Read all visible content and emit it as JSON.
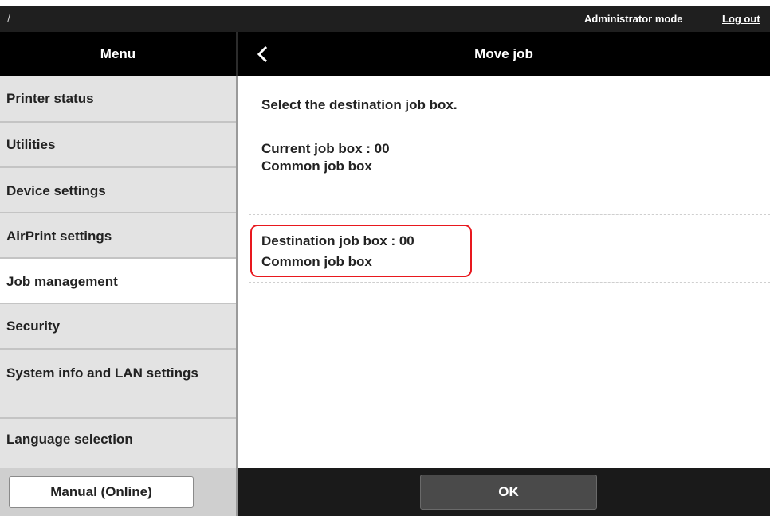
{
  "topbar": {
    "path": "/",
    "mode_label": "Administrator mode",
    "logout_label": "Log out"
  },
  "header": {
    "menu_title": "Menu",
    "back_icon": "chevron-left-icon",
    "page_title": "Move job"
  },
  "sidebar": {
    "items": [
      {
        "label": "Printer status",
        "active": false
      },
      {
        "label": "Utilities",
        "active": false
      },
      {
        "label": "Device settings",
        "active": false
      },
      {
        "label": "AirPrint settings",
        "active": false
      },
      {
        "label": "Job management",
        "active": true
      },
      {
        "label": "Security",
        "active": false
      },
      {
        "label": "System info and LAN settings",
        "active": false
      },
      {
        "label": "Language selection",
        "active": false
      }
    ]
  },
  "main": {
    "instruction": "Select the destination job box.",
    "current_box": {
      "line1": "Current job box : 00",
      "line2": "Common job box"
    },
    "destination_box": {
      "line1": "Destination job box : 00",
      "line2": "Common job box"
    }
  },
  "footer": {
    "manual_label": "Manual (Online)",
    "ok_label": "OK"
  },
  "colors": {
    "header_bg": "#000000",
    "sidebar_bg": "#e3e3e3",
    "active_item_bg": "#ffffff",
    "highlight_border": "#e8181e",
    "ok_button_bg": "#4a4a4a"
  }
}
